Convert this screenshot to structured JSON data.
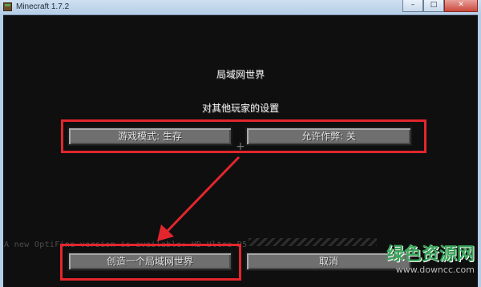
{
  "window": {
    "title": "Minecraft 1.7.2",
    "minimize_glyph": "–",
    "maximize_glyph": "□",
    "close_glyph": "✕"
  },
  "screen": {
    "title": "局域网世界",
    "section_title": "对其他玩家的设置"
  },
  "buttons": {
    "game_mode": "游戏模式: 生存",
    "allow_cheats": "允许作弊: 关",
    "start_lan": "创造一个局域网世界",
    "cancel": "取消"
  },
  "notice": "A new OptiFine version is available: HD Ultra D5",
  "watermark": {
    "main": "绿色资源网",
    "sub": "www.downcc.com"
  },
  "colors": {
    "highlight": "#e3262d",
    "button_face": "#6f6f6f",
    "text": "#e0e0e0"
  },
  "icons": {
    "app": "minecraft-grass-block-icon",
    "crosshair": "crosshair-icon"
  }
}
